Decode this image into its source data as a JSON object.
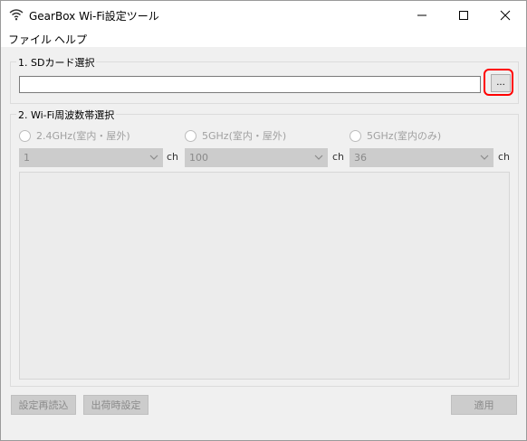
{
  "window": {
    "title": "GearBox Wi-Fi設定ツール",
    "controls": {
      "minimize": "—",
      "maximize": "☐",
      "close": "✕"
    }
  },
  "menu": {
    "file": "ファイル",
    "help": "ヘルプ"
  },
  "sd_section": {
    "label": "1. SDカード選択",
    "path_value": "",
    "browse_label": "..."
  },
  "wifi_section": {
    "label": "2. Wi-Fi周波数帯選択",
    "radios": [
      {
        "label": "2.4GHz(室内・屋外)",
        "checked": false
      },
      {
        "label": "5GHz(室内・屋外)",
        "checked": false
      },
      {
        "label": "5GHz(室内のみ)",
        "checked": false
      }
    ],
    "channels": [
      {
        "value": "1",
        "unit": "ch"
      },
      {
        "value": "100",
        "unit": "ch"
      },
      {
        "value": "36",
        "unit": "ch"
      }
    ]
  },
  "buttons": {
    "reload": "設定再読込",
    "factory": "出荷時設定",
    "apply": "適用"
  },
  "colors": {
    "highlight": "#ff0000",
    "disabled_text": "#8a8a8a"
  }
}
